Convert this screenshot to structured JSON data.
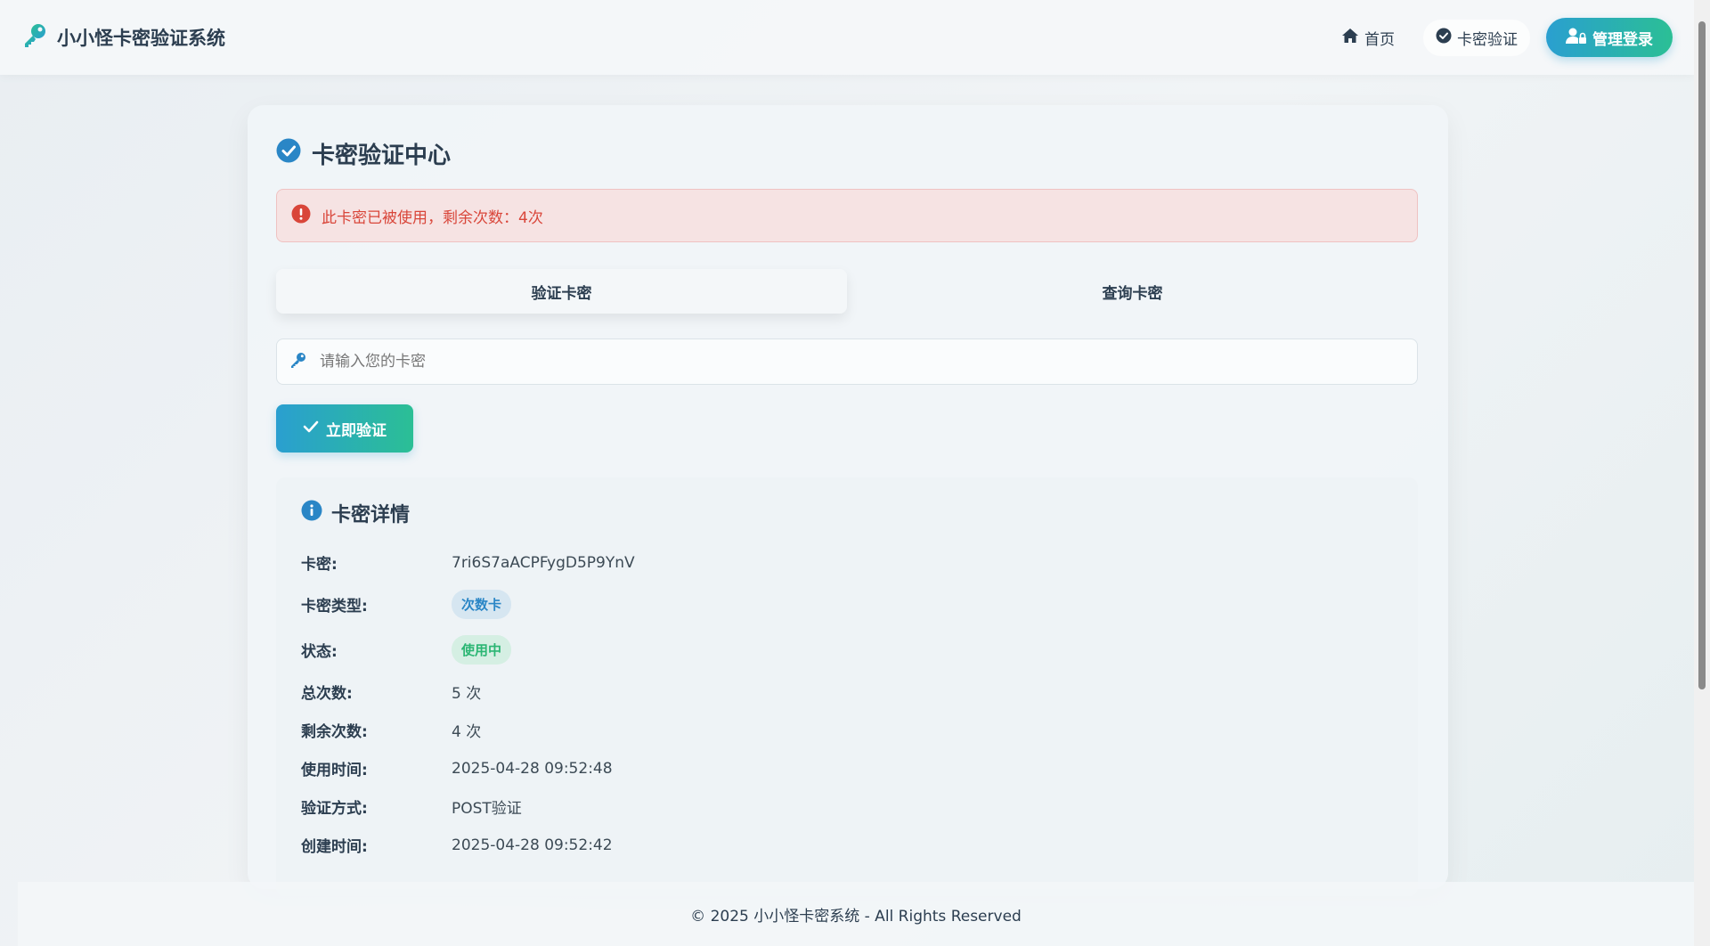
{
  "brand": {
    "title": "小小怪卡密验证系统",
    "icon": "key-icon"
  },
  "nav": {
    "home_label": "首页",
    "verify_label": "卡密验证",
    "admin_label": "管理登录"
  },
  "card": {
    "title": "卡密验证中心",
    "alert": "此卡密已被使用，剩余次数：4次",
    "tabs": [
      "验证卡密",
      "查询卡密"
    ],
    "input_placeholder": "请输入您的卡密",
    "verify_button": "立即验证"
  },
  "details": {
    "title": "卡密详情",
    "rows": [
      {
        "label": "卡密:",
        "value": "7ri6S7aACPFygD5P9YnV"
      },
      {
        "label": "卡密类型:",
        "value": "次数卡"
      },
      {
        "label": "状态:",
        "value": "使用中"
      },
      {
        "label": "总次数:",
        "value": "5 次"
      },
      {
        "label": "剩余次数:",
        "value": "4 次"
      },
      {
        "label": "使用时间:",
        "value": "2025-04-28 09:52:48"
      },
      {
        "label": "验证方式:",
        "value": "POST验证"
      },
      {
        "label": "创建时间:",
        "value": "2025-04-28 09:52:42"
      }
    ]
  },
  "footer": {
    "text": "© 2025 小小怪卡密系统 - All Rights Reserved"
  },
  "colors": {
    "accent_start": "#2a9fd0",
    "accent_end": "#2bbf95",
    "error": "#d9463a",
    "badge_blue": "#2a86c6",
    "badge_green": "#2bb673"
  }
}
